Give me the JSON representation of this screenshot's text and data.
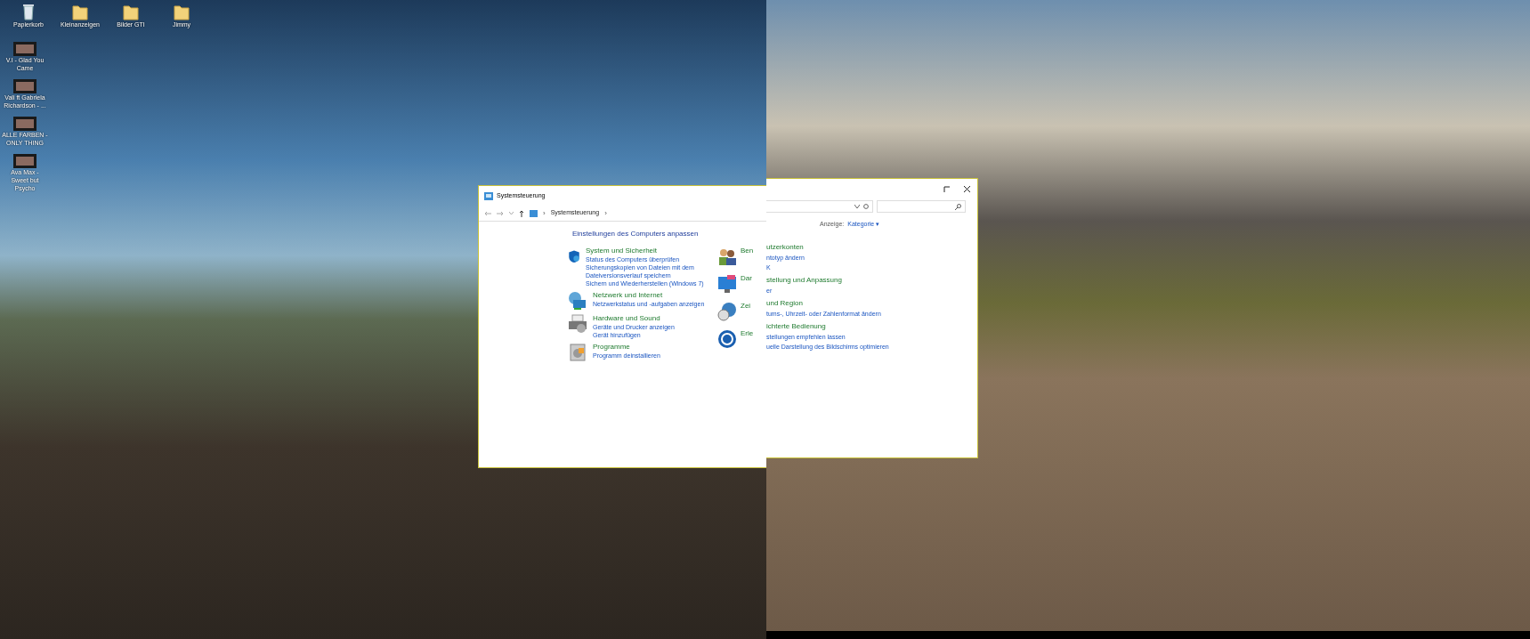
{
  "desktop_icons": [
    {
      "label": "Papierkorb",
      "kind": "bin"
    },
    {
      "label": "Kleinanzeigen",
      "kind": "folder"
    },
    {
      "label": "Bilder GTI",
      "kind": "folder"
    },
    {
      "label": "Jimmy",
      "kind": "folder"
    },
    {
      "label": "V.I - Glad You Came",
      "kind": "video"
    },
    {
      "label": "Vali ft Gabriela Richardson - ...",
      "kind": "video"
    },
    {
      "label": "ALLE FARBEN - ONLY THING",
      "kind": "video"
    },
    {
      "label": "Ava Max - Sweet but Psycho",
      "kind": "video"
    }
  ],
  "window": {
    "title": "Systemsteuerung",
    "breadcrumb": "Systemsteuerung",
    "breadcrumb_separator": "›",
    "heading": "Einstellungen des Computers anpassen",
    "categories": [
      {
        "title": "System und Sicherheit",
        "kind": "shield",
        "links": [
          "Status des Computers überprüfen",
          "Sicherungskopien von Dateien mit dem Dateiversionsverlauf speichern",
          "Sichern und Wiederherstellen (Windows 7)"
        ]
      },
      {
        "title": "Netzwerk und Internet",
        "kind": "network",
        "links": [
          "Netzwerkstatus und -aufgaben anzeigen"
        ]
      },
      {
        "title": "Hardware und Sound",
        "kind": "printer",
        "links": [
          "Geräte und Drucker anzeigen",
          "Gerät hinzufügen"
        ]
      },
      {
        "title": "Programme",
        "kind": "programs",
        "links": [
          "Programm deinstallieren"
        ]
      }
    ],
    "right_column": [
      {
        "title": "Ben",
        "kind": "users"
      },
      {
        "title": "Dar",
        "kind": "display"
      },
      {
        "title": "Zei",
        "kind": "clock"
      },
      {
        "title": "Erle",
        "kind": "access"
      }
    ]
  },
  "window_right_part": {
    "view_label": "Anzeige:",
    "view_value": "Kategorie ▾",
    "lines": [
      {
        "text": "utzerkonten",
        "kind": "heading"
      },
      {
        "text": "ntotyp ändern",
        "kind": "link"
      },
      {
        "text": "K",
        "kind": "link"
      },
      {
        "text": "stellung und Anpassung",
        "kind": "heading"
      },
      {
        "text": "er",
        "kind": "link"
      },
      {
        "text": "und Region",
        "kind": "heading"
      },
      {
        "text": "tums-, Uhrzeit- oder Zahlenformat ändern",
        "kind": "link"
      },
      {
        "text": "ichterte Bedienung",
        "kind": "heading"
      },
      {
        "text": "stellungen empfehlen lassen",
        "kind": "link"
      },
      {
        "text": "uelle Darstellung des Bildschirms optimieren",
        "kind": "link"
      }
    ]
  }
}
